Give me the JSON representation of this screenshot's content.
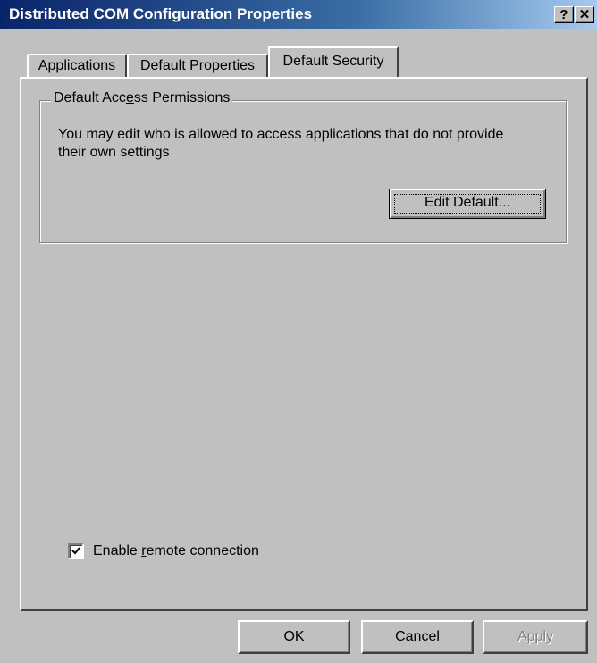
{
  "window": {
    "title": "Distributed COM Configuration Properties",
    "help_glyph": "?",
    "close_glyph": "✕"
  },
  "tabs": [
    {
      "label": "Applications",
      "active": false
    },
    {
      "label": "Default Properties",
      "active": false
    },
    {
      "label": "Default Security",
      "active": true
    }
  ],
  "access_group": {
    "legend_pre": "Default Acc",
    "legend_mnemonic": "e",
    "legend_post": "ss Permissions",
    "description": "You may edit who is allowed to access applications that do not provide their own settings",
    "edit_button": "Edit Default..."
  },
  "remote": {
    "checked": true,
    "label_pre": "Enable ",
    "label_mnemonic": "r",
    "label_post": "emote connection"
  },
  "buttons": {
    "ok": "OK",
    "cancel": "Cancel",
    "apply": "Apply",
    "apply_enabled": false
  },
  "colors": {
    "face": "#c0c0c0",
    "title_start": "#0a246a",
    "title_end": "#a6caf0",
    "disabled_text": "#808080"
  },
  "icons": {
    "help": "help-icon",
    "close": "close-icon",
    "checkmark": "checkmark-icon"
  }
}
